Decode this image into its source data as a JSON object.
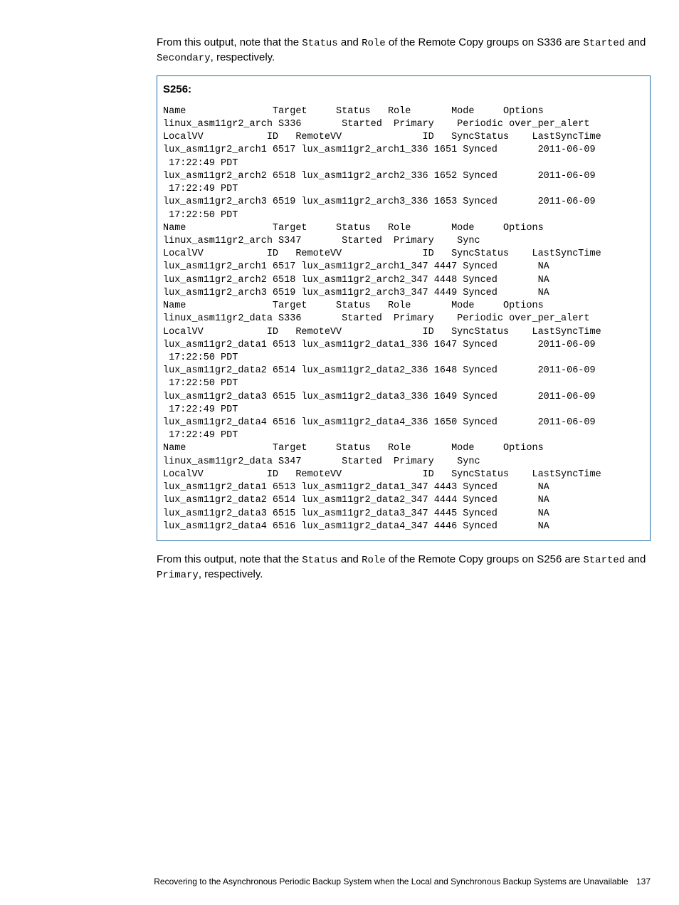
{
  "paragraph1": {
    "t1": "From this output, note that the ",
    "c1": "Status",
    "t2": " and ",
    "c2": "Role",
    "t3": " of the Remote Copy groups on S336 are ",
    "c3": "Started",
    "t4": " and ",
    "c4": "Secondary",
    "t5": ", respectively."
  },
  "codebox": {
    "label": "S256:",
    "text": "Name               Target     Status   Role       Mode     Options\nlinux_asm11gr2_arch S336       Started  Primary    Periodic over_per_alert\nLocalVV           ID   RemoteVV              ID   SyncStatus    LastSyncTime\nlux_asm11gr2_arch1 6517 lux_asm11gr2_arch1_336 1651 Synced       2011-06-09\n 17:22:49 PDT\nlux_asm11gr2_arch2 6518 lux_asm11gr2_arch2_336 1652 Synced       2011-06-09\n 17:22:49 PDT\nlux_asm11gr2_arch3 6519 lux_asm11gr2_arch3_336 1653 Synced       2011-06-09\n 17:22:50 PDT\nName               Target     Status   Role       Mode     Options\nlinux_asm11gr2_arch S347       Started  Primary    Sync\nLocalVV           ID   RemoteVV              ID   SyncStatus    LastSyncTime\nlux_asm11gr2_arch1 6517 lux_asm11gr2_arch1_347 4447 Synced       NA\nlux_asm11gr2_arch2 6518 lux_asm11gr2_arch2_347 4448 Synced       NA\nlux_asm11gr2_arch3 6519 lux_asm11gr2_arch3_347 4449 Synced       NA\nName               Target     Status   Role       Mode     Options\nlinux_asm11gr2_data S336       Started  Primary    Periodic over_per_alert\nLocalVV           ID   RemoteVV              ID   SyncStatus    LastSyncTime\nlux_asm11gr2_data1 6513 lux_asm11gr2_data1_336 1647 Synced       2011-06-09\n 17:22:50 PDT\nlux_asm11gr2_data2 6514 lux_asm11gr2_data2_336 1648 Synced       2011-06-09\n 17:22:50 PDT\nlux_asm11gr2_data3 6515 lux_asm11gr2_data3_336 1649 Synced       2011-06-09\n 17:22:49 PDT\nlux_asm11gr2_data4 6516 lux_asm11gr2_data4_336 1650 Synced       2011-06-09\n 17:22:49 PDT\nName               Target     Status   Role       Mode     Options\nlinux_asm11gr2_data S347       Started  Primary    Sync\nLocalVV           ID   RemoteVV              ID   SyncStatus    LastSyncTime\nlux_asm11gr2_data1 6513 lux_asm11gr2_data1_347 4443 Synced       NA\nlux_asm11gr2_data2 6514 lux_asm11gr2_data2_347 4444 Synced       NA\nlux_asm11gr2_data3 6515 lux_asm11gr2_data3_347 4445 Synced       NA\nlux_asm11gr2_data4 6516 lux_asm11gr2_data4_347 4446 Synced       NA"
  },
  "paragraph2": {
    "t1": "From this output, note that the ",
    "c1": "Status",
    "t2": " and ",
    "c2": "Role",
    "t3": " of the Remote Copy groups on S256 are ",
    "c3": "Started",
    "t4": " and ",
    "c4": "Primary",
    "t5": ", respectively."
  },
  "footer": {
    "title": "Recovering to the Asynchronous Periodic Backup System when the Local and Synchronous Backup Systems are Unavailable",
    "page": "137"
  }
}
